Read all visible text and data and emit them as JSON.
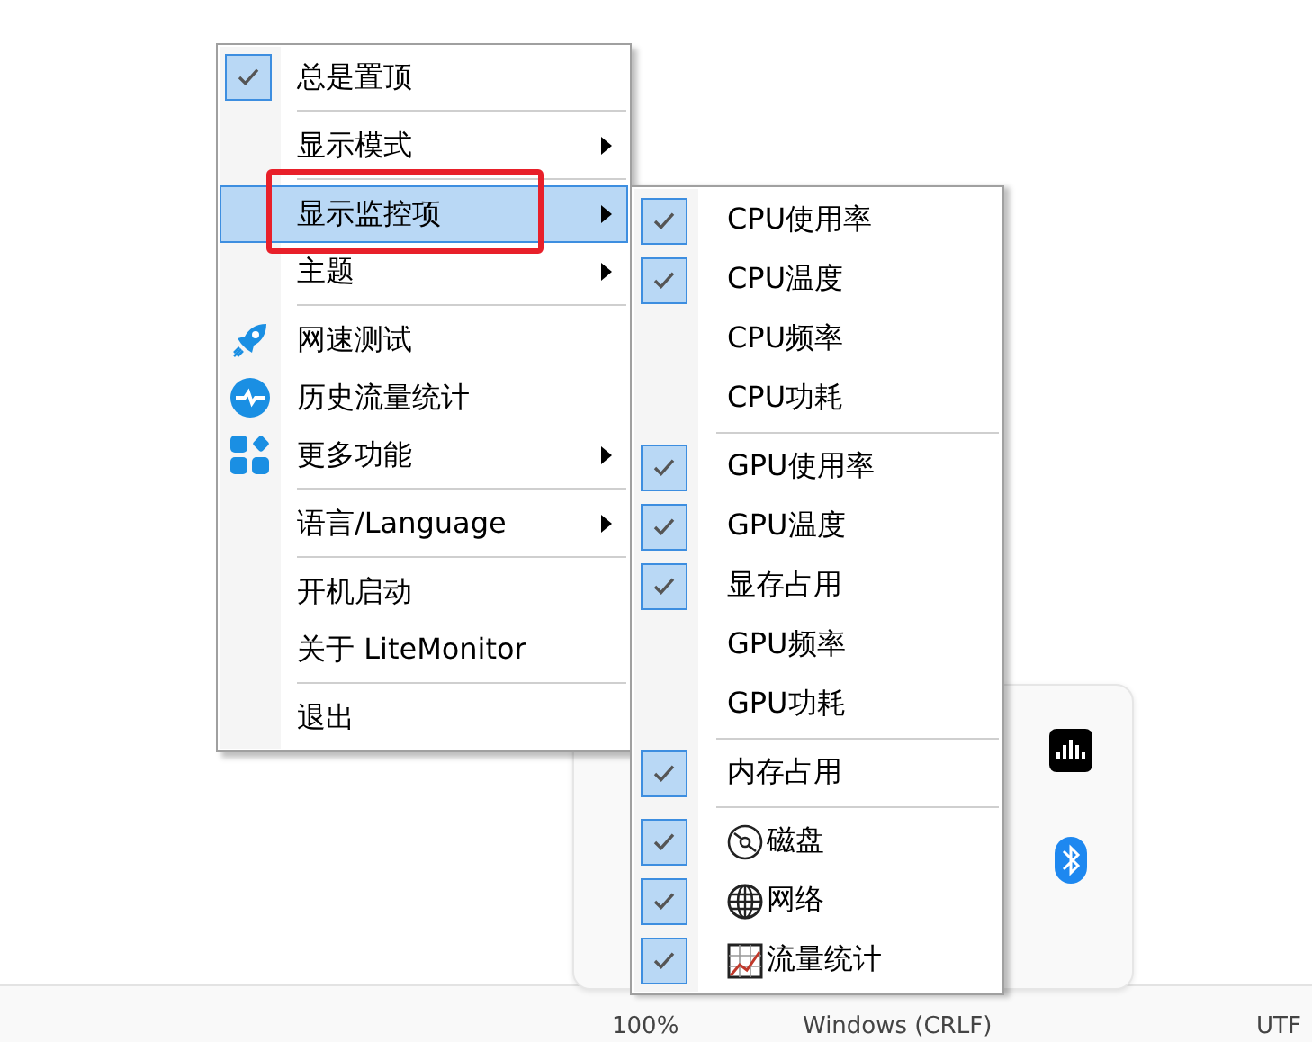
{
  "menu": {
    "groups": [
      {
        "items": [
          {
            "label": "总是置顶",
            "checked": true,
            "submenu": false,
            "selected": false
          }
        ]
      },
      {
        "items": [
          {
            "label": "显示模式",
            "checked": false,
            "submenu": true,
            "selected": false
          }
        ]
      },
      {
        "items": [
          {
            "label": "显示监控项",
            "checked": false,
            "submenu": true,
            "selected": true,
            "annotated": true
          },
          {
            "label": "主题",
            "checked": false,
            "submenu": true,
            "selected": false
          }
        ]
      },
      {
        "items": [
          {
            "label": "网速测试",
            "checked": false,
            "submenu": false,
            "selected": false,
            "kind": "rocket"
          },
          {
            "label": "历史流量统计",
            "checked": false,
            "submenu": false,
            "selected": false,
            "kind": "pulse"
          },
          {
            "label": "更多功能",
            "checked": false,
            "submenu": true,
            "selected": false,
            "kind": "apps"
          }
        ]
      },
      {
        "items": [
          {
            "label": "语言/Language",
            "checked": false,
            "submenu": true,
            "selected": false
          }
        ]
      },
      {
        "items": [
          {
            "label": "开机启动",
            "checked": false,
            "submenu": false,
            "selected": false
          },
          {
            "label": "关于 LiteMonitor",
            "checked": false,
            "submenu": false,
            "selected": false
          }
        ]
      },
      {
        "items": [
          {
            "label": "退出",
            "checked": false,
            "submenu": false,
            "selected": false
          }
        ]
      }
    ]
  },
  "submenu": {
    "groups": [
      {
        "items": [
          {
            "label": "CPU使用率",
            "checked": true
          },
          {
            "label": "CPU温度",
            "checked": true
          },
          {
            "label": "CPU频率",
            "checked": false
          },
          {
            "label": "CPU功耗",
            "checked": false
          }
        ]
      },
      {
        "items": [
          {
            "label": "GPU使用率",
            "checked": true
          },
          {
            "label": "GPU温度",
            "checked": true
          },
          {
            "label": "显存占用",
            "checked": true
          },
          {
            "label": "GPU频率",
            "checked": false
          },
          {
            "label": "GPU功耗",
            "checked": false
          }
        ]
      },
      {
        "items": [
          {
            "label": "内存占用",
            "checked": true
          }
        ]
      },
      {
        "items": [
          {
            "label": "磁盘",
            "checked": true,
            "kind": "disc"
          },
          {
            "label": "网络",
            "checked": true,
            "kind": "globe"
          },
          {
            "label": "流量统计",
            "checked": true,
            "kind": "chart"
          }
        ]
      }
    ]
  },
  "tray_flyout": {
    "icons": [
      {
        "kind": "audio"
      },
      {
        "kind": "bluetooth"
      }
    ]
  },
  "status_bar": {
    "items": [
      "100%",
      "Windows (CRLF)",
      "UTF"
    ]
  }
}
